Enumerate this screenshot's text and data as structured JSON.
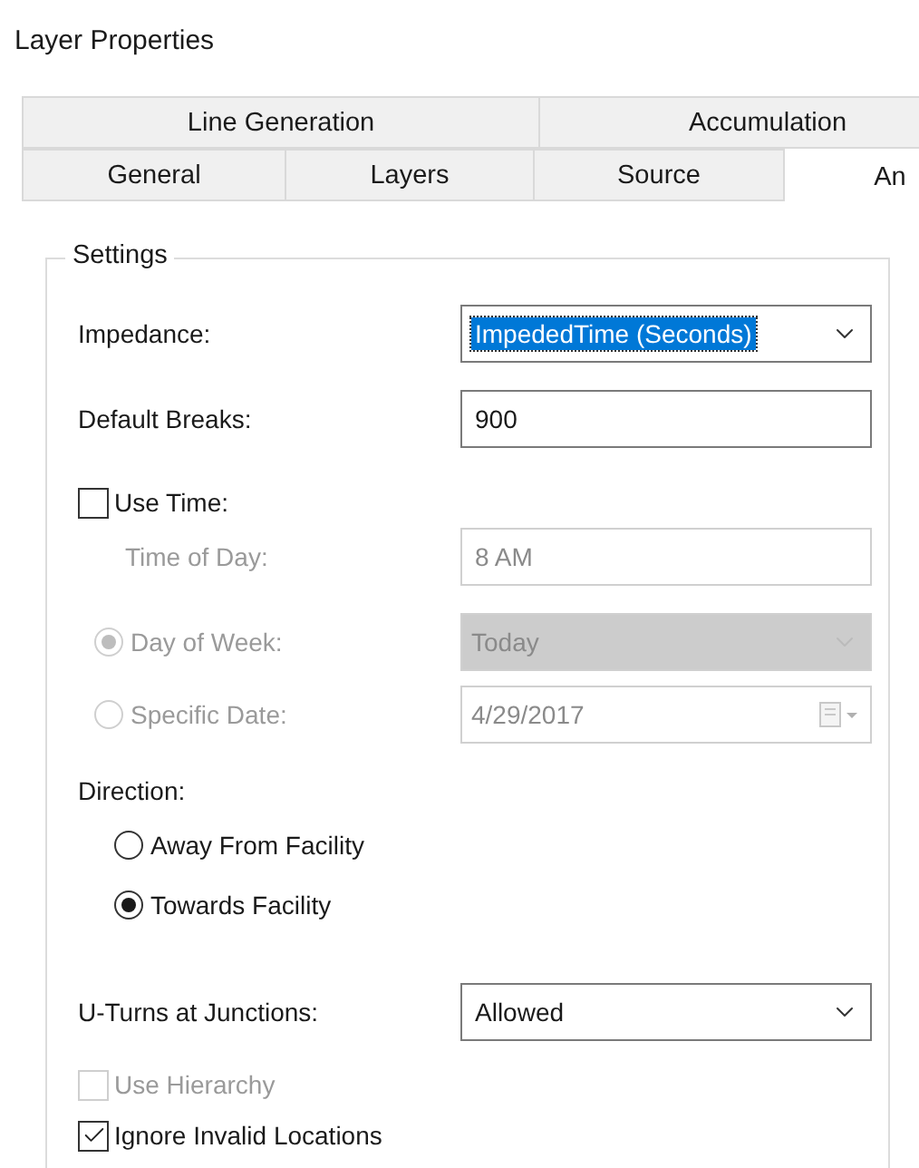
{
  "window": {
    "title": "Layer Properties"
  },
  "tab_rows": [
    [
      {
        "label": "Line Generation",
        "selected": false
      },
      {
        "label": "Accumulation",
        "selected": false
      }
    ],
    [
      {
        "label": "General",
        "selected": false
      },
      {
        "label": "Layers",
        "selected": false
      },
      {
        "label": "Source",
        "selected": false
      },
      {
        "label": "An",
        "selected": true
      }
    ]
  ],
  "settings": {
    "title": "Settings",
    "rows": [
      {
        "kind": "select",
        "label": "Impedance:",
        "value": "ImpededTime (Seconds)",
        "focused": true
      },
      {
        "kind": "input",
        "label": "Default Breaks:",
        "value": "900"
      },
      {
        "kind": "checkbox",
        "label": "Use Time:",
        "checked": false,
        "disabled": false,
        "children": [
          {
            "kind": "input",
            "label": "Time of Day:",
            "value": "8 AM",
            "disabled": true
          },
          {
            "kind": "radio-select",
            "label": "Day of Week:",
            "selected": true,
            "value": "Today",
            "disabled": true
          },
          {
            "kind": "radio-date",
            "label": "Specific Date:",
            "selected": false,
            "value": "4/29/2017",
            "disabled": true
          }
        ]
      },
      {
        "kind": "heading",
        "label": "Direction:",
        "children": [
          {
            "kind": "radio",
            "label": "Away From Facility",
            "selected": false
          },
          {
            "kind": "radio",
            "label": "Towards Facility",
            "selected": true
          }
        ]
      },
      {
        "kind": "select",
        "label": "U-Turns at Junctions:",
        "value": "Allowed",
        "focused": false
      },
      {
        "kind": "checkbox",
        "label": "Use Hierarchy",
        "checked": false,
        "disabled": true
      },
      {
        "kind": "checkbox",
        "label": "Ignore Invalid Locations",
        "checked": true,
        "disabled": false
      }
    ]
  }
}
